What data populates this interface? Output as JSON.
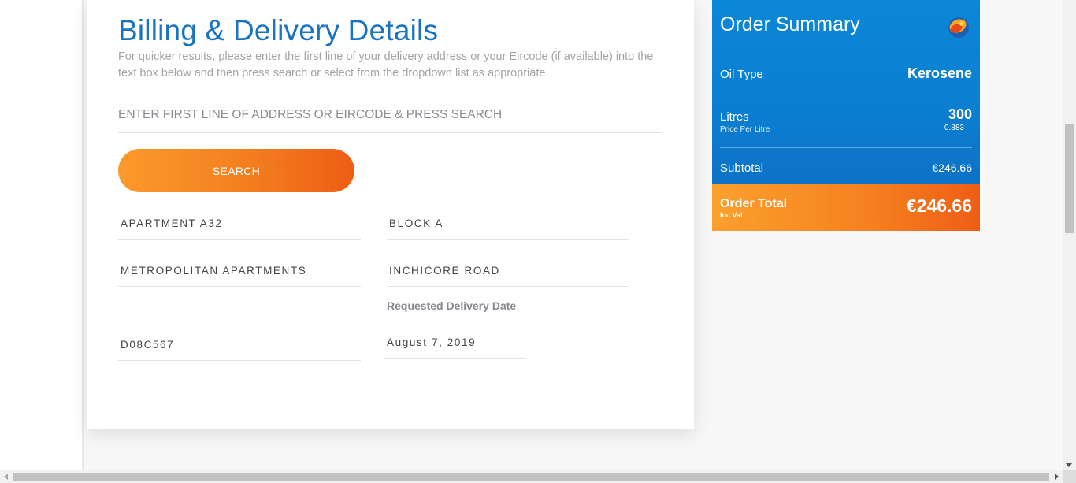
{
  "billing": {
    "title": "Billing & Delivery Details",
    "intro": "For quicker results, please enter the first line of your delivery address or your Eircode (if available) into the text box below and then press search or select from the dropdown list as appropriate.",
    "search_placeholder": "ENTER FIRST LINE OF ADDRESS OR EIRCODE & PRESS SEARCH",
    "search_button": "SEARCH",
    "fields": {
      "address_line1": "APARTMENT A32",
      "address_line2": "BLOCK A",
      "address_line3": "METROPOLITAN APARTMENTS",
      "address_line4": "INCHICORE ROAD",
      "eircode": "D08C567",
      "delivery_date_label": "Requested Delivery Date",
      "delivery_date": "August 7, 2019"
    }
  },
  "summary": {
    "title": "Order Summary",
    "logo_icon": "oil-drop-logo-icon",
    "oil_type_label": "Oil Type",
    "oil_type_value": "Kerosene",
    "litres_label": "Litres",
    "litres_value": "300",
    "price_per_litre_label": "Price Per Litre",
    "price_per_litre_value": "0.883",
    "subtotal_label": "Subtotal",
    "subtotal_value": "€246.66",
    "total_label": "Order Total",
    "total_sub": "Inc Vat",
    "total_value": "€246.66"
  },
  "colors": {
    "brand_blue": "#1a73c0",
    "summary_blue": "#0b7ed1",
    "accent_orange": "#f37f1f"
  }
}
